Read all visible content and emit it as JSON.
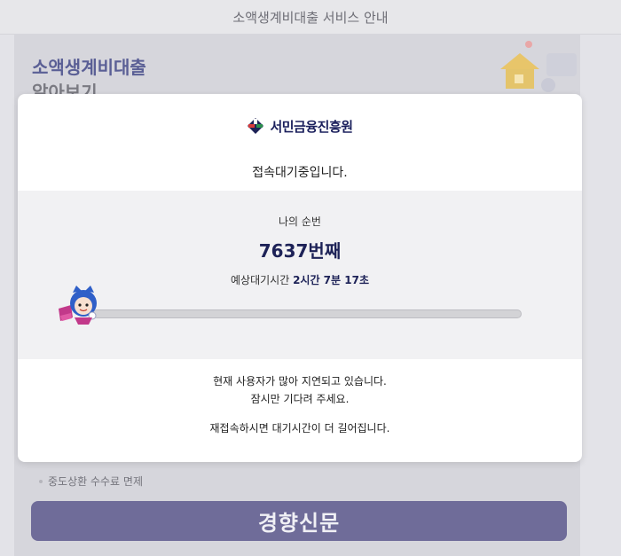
{
  "topbar": {
    "title": "소액생계비대출 서비스 안내"
  },
  "background": {
    "heading_line1": "소액생계비대출",
    "heading_line2": "알아보기",
    "feature_item": "중도상환 수수료 면제",
    "button_watermark": "경향신문"
  },
  "modal": {
    "logo_text": "서민금융진흥원",
    "status_title": "접속대기중입니다.",
    "my_order_label": "나의 순번",
    "queue_number": "7637번째",
    "eta_label": "예상대기시간",
    "eta_value": "2시간 7분 17초",
    "progress_fraction": 0.0,
    "message_line1": "현재 사용자가 많아 지연되고 있습니다.",
    "message_line2": "잠시만 기다려 주세요.",
    "message_line3": "재접속하시면 대기시간이 더 길어집니다."
  },
  "colors": {
    "brand_navy": "#1d2257",
    "accent_purple": "#6f6c99",
    "heading_purple": "#5a5f95"
  }
}
